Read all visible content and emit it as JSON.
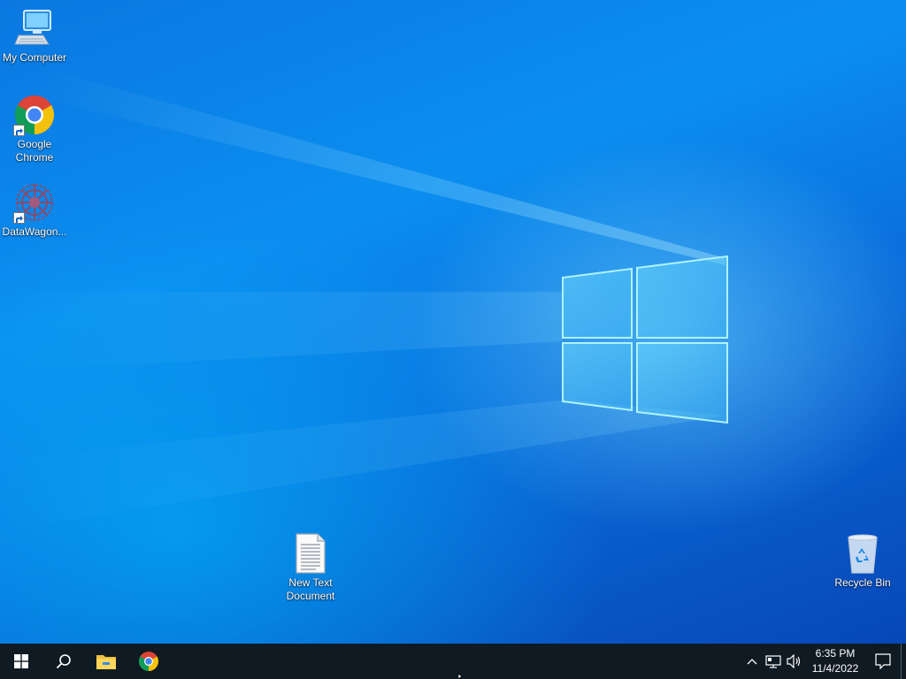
{
  "desktop": {
    "icons": {
      "my_computer": {
        "label": "My Computer",
        "icon": "computer-icon"
      },
      "chrome": {
        "label": "Google Chrome",
        "icon": "chrome-icon"
      },
      "datawagon": {
        "label": "DataWagon...",
        "icon": "datawagon-icon"
      },
      "text_doc": {
        "label": "New Text Document",
        "icon": "text-document-icon"
      },
      "recycle_bin": {
        "label": "Recycle Bin",
        "icon": "recycle-bin-icon"
      }
    }
  },
  "taskbar": {
    "start": {
      "icon": "windows-logo-icon"
    },
    "search": {
      "icon": "search-icon"
    },
    "pinned": [
      {
        "name": "File Explorer",
        "icon": "folder-icon"
      },
      {
        "name": "Google Chrome",
        "icon": "chrome-icon"
      }
    ],
    "tray": {
      "show_hidden": {
        "icon": "chevron-up-icon"
      },
      "network": {
        "icon": "network-icon"
      },
      "volume": {
        "icon": "speaker-icon"
      },
      "time": "6:35 PM",
      "date": "11/4/2022",
      "notifications": {
        "icon": "action-center-icon"
      }
    }
  },
  "colors": {
    "taskbar_bg": "#0f1a23",
    "desktop_blue": "#0a78e0",
    "logo_glow": "#7fe3ff"
  }
}
